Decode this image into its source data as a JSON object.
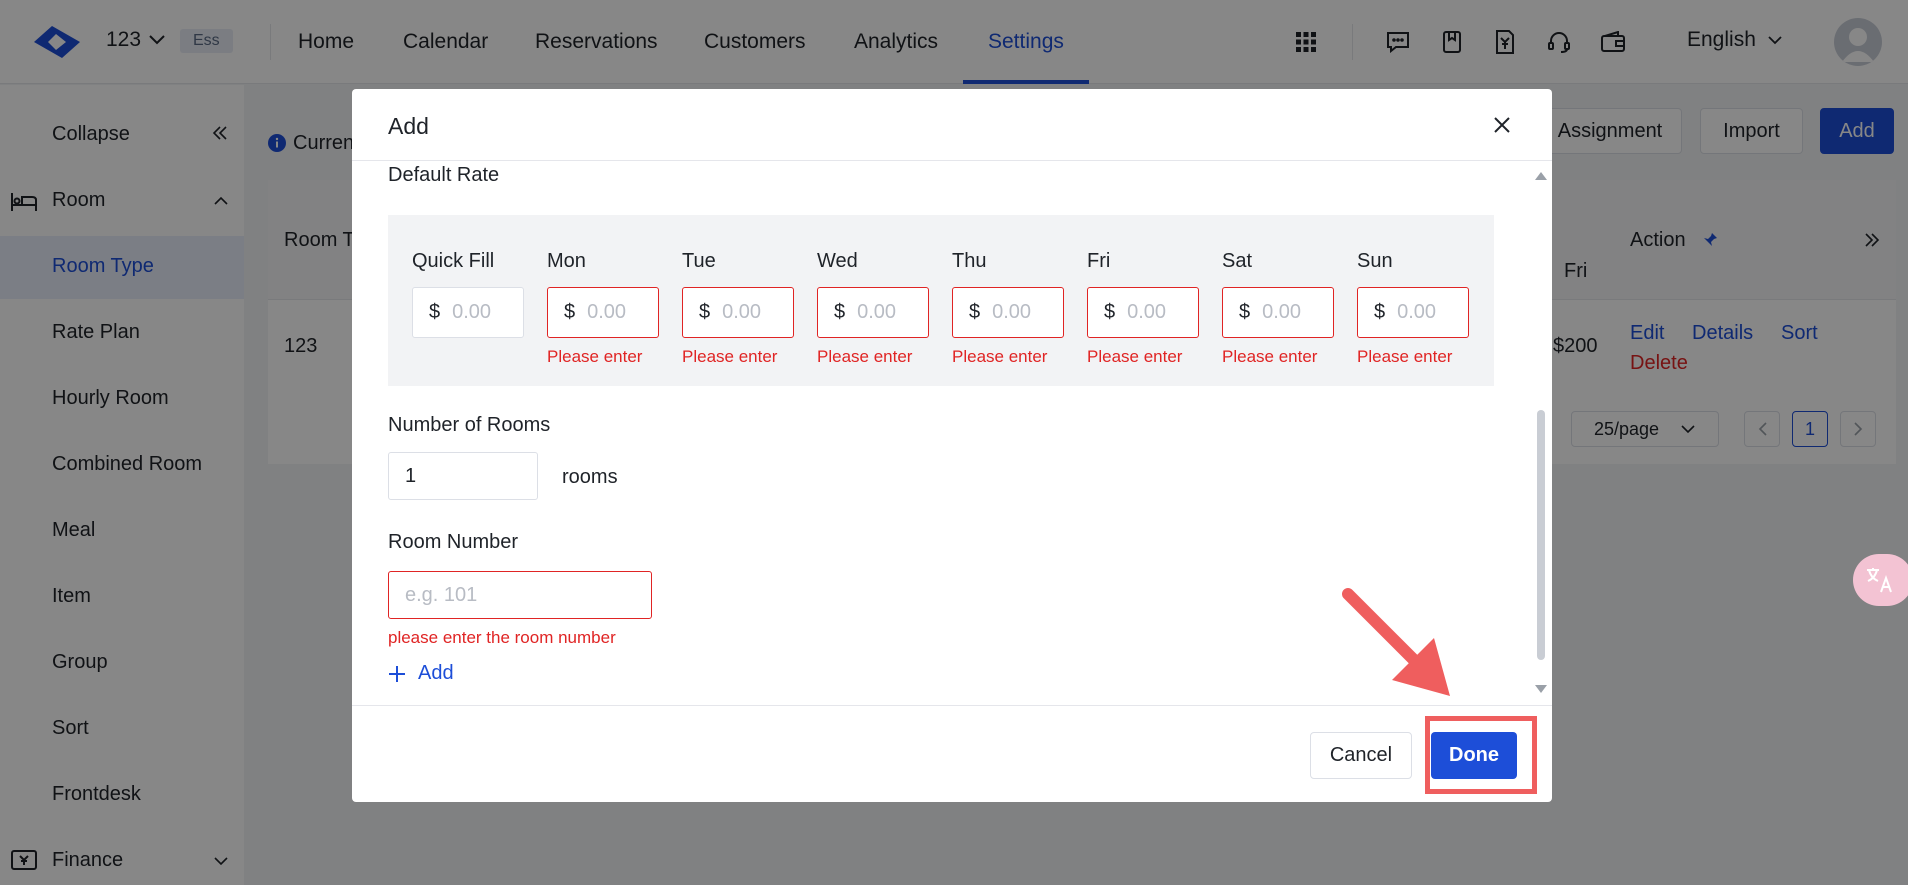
{
  "topbar": {
    "hotel_name": "123",
    "plan_badge": "Ess",
    "nav": [
      "Home",
      "Calendar",
      "Reservations",
      "Customers",
      "Analytics",
      "Settings"
    ],
    "active_nav": "Settings",
    "language": "English"
  },
  "sidebar": {
    "collapse": "Collapse",
    "room_group": "Room",
    "items": [
      "Room Type",
      "Rate Plan",
      "Hourly Room",
      "Combined Room",
      "Meal",
      "Item",
      "Group",
      "Sort",
      "Frontdesk"
    ],
    "finance_group": "Finance"
  },
  "page": {
    "info_text": "Curren",
    "buttons": {
      "assignment": "Assignment",
      "import": "Import",
      "add": "Add"
    },
    "table": {
      "col_room_type": "Room T",
      "col_fri": "Fri",
      "col_action": "Action",
      "row": {
        "name": "123",
        "fri_price": "$200"
      },
      "actions": {
        "edit": "Edit",
        "details": "Details",
        "sort": "Sort",
        "delete": "Delete"
      }
    },
    "pagination": {
      "page_size": "25/page",
      "current_page": "1"
    }
  },
  "modal": {
    "title": "Add",
    "default_rate_label": "Default Rate",
    "rate_columns": [
      {
        "day": "Quick Fill",
        "error": ""
      },
      {
        "day": "Mon",
        "error": "Please enter"
      },
      {
        "day": "Tue",
        "error": "Please enter"
      },
      {
        "day": "Wed",
        "error": "Please enter"
      },
      {
        "day": "Thu",
        "error": "Please enter"
      },
      {
        "day": "Fri",
        "error": "Please enter"
      },
      {
        "day": "Sat",
        "error": "Please enter"
      },
      {
        "day": "Sun",
        "error": "Please enter"
      }
    ],
    "currency_symbol": "$",
    "rate_placeholder": "0.00",
    "rooms_label": "Number of Rooms",
    "rooms_value": "1",
    "rooms_unit": "rooms",
    "room_number_label": "Room Number",
    "room_number_placeholder": "e.g. 101",
    "room_number_error": "please enter the room number",
    "add_link": "Add",
    "cancel": "Cancel",
    "done": "Done"
  },
  "colors": {
    "primary": "#1d4ed8",
    "error": "#e02424",
    "highlight": "#ef5e5e"
  }
}
